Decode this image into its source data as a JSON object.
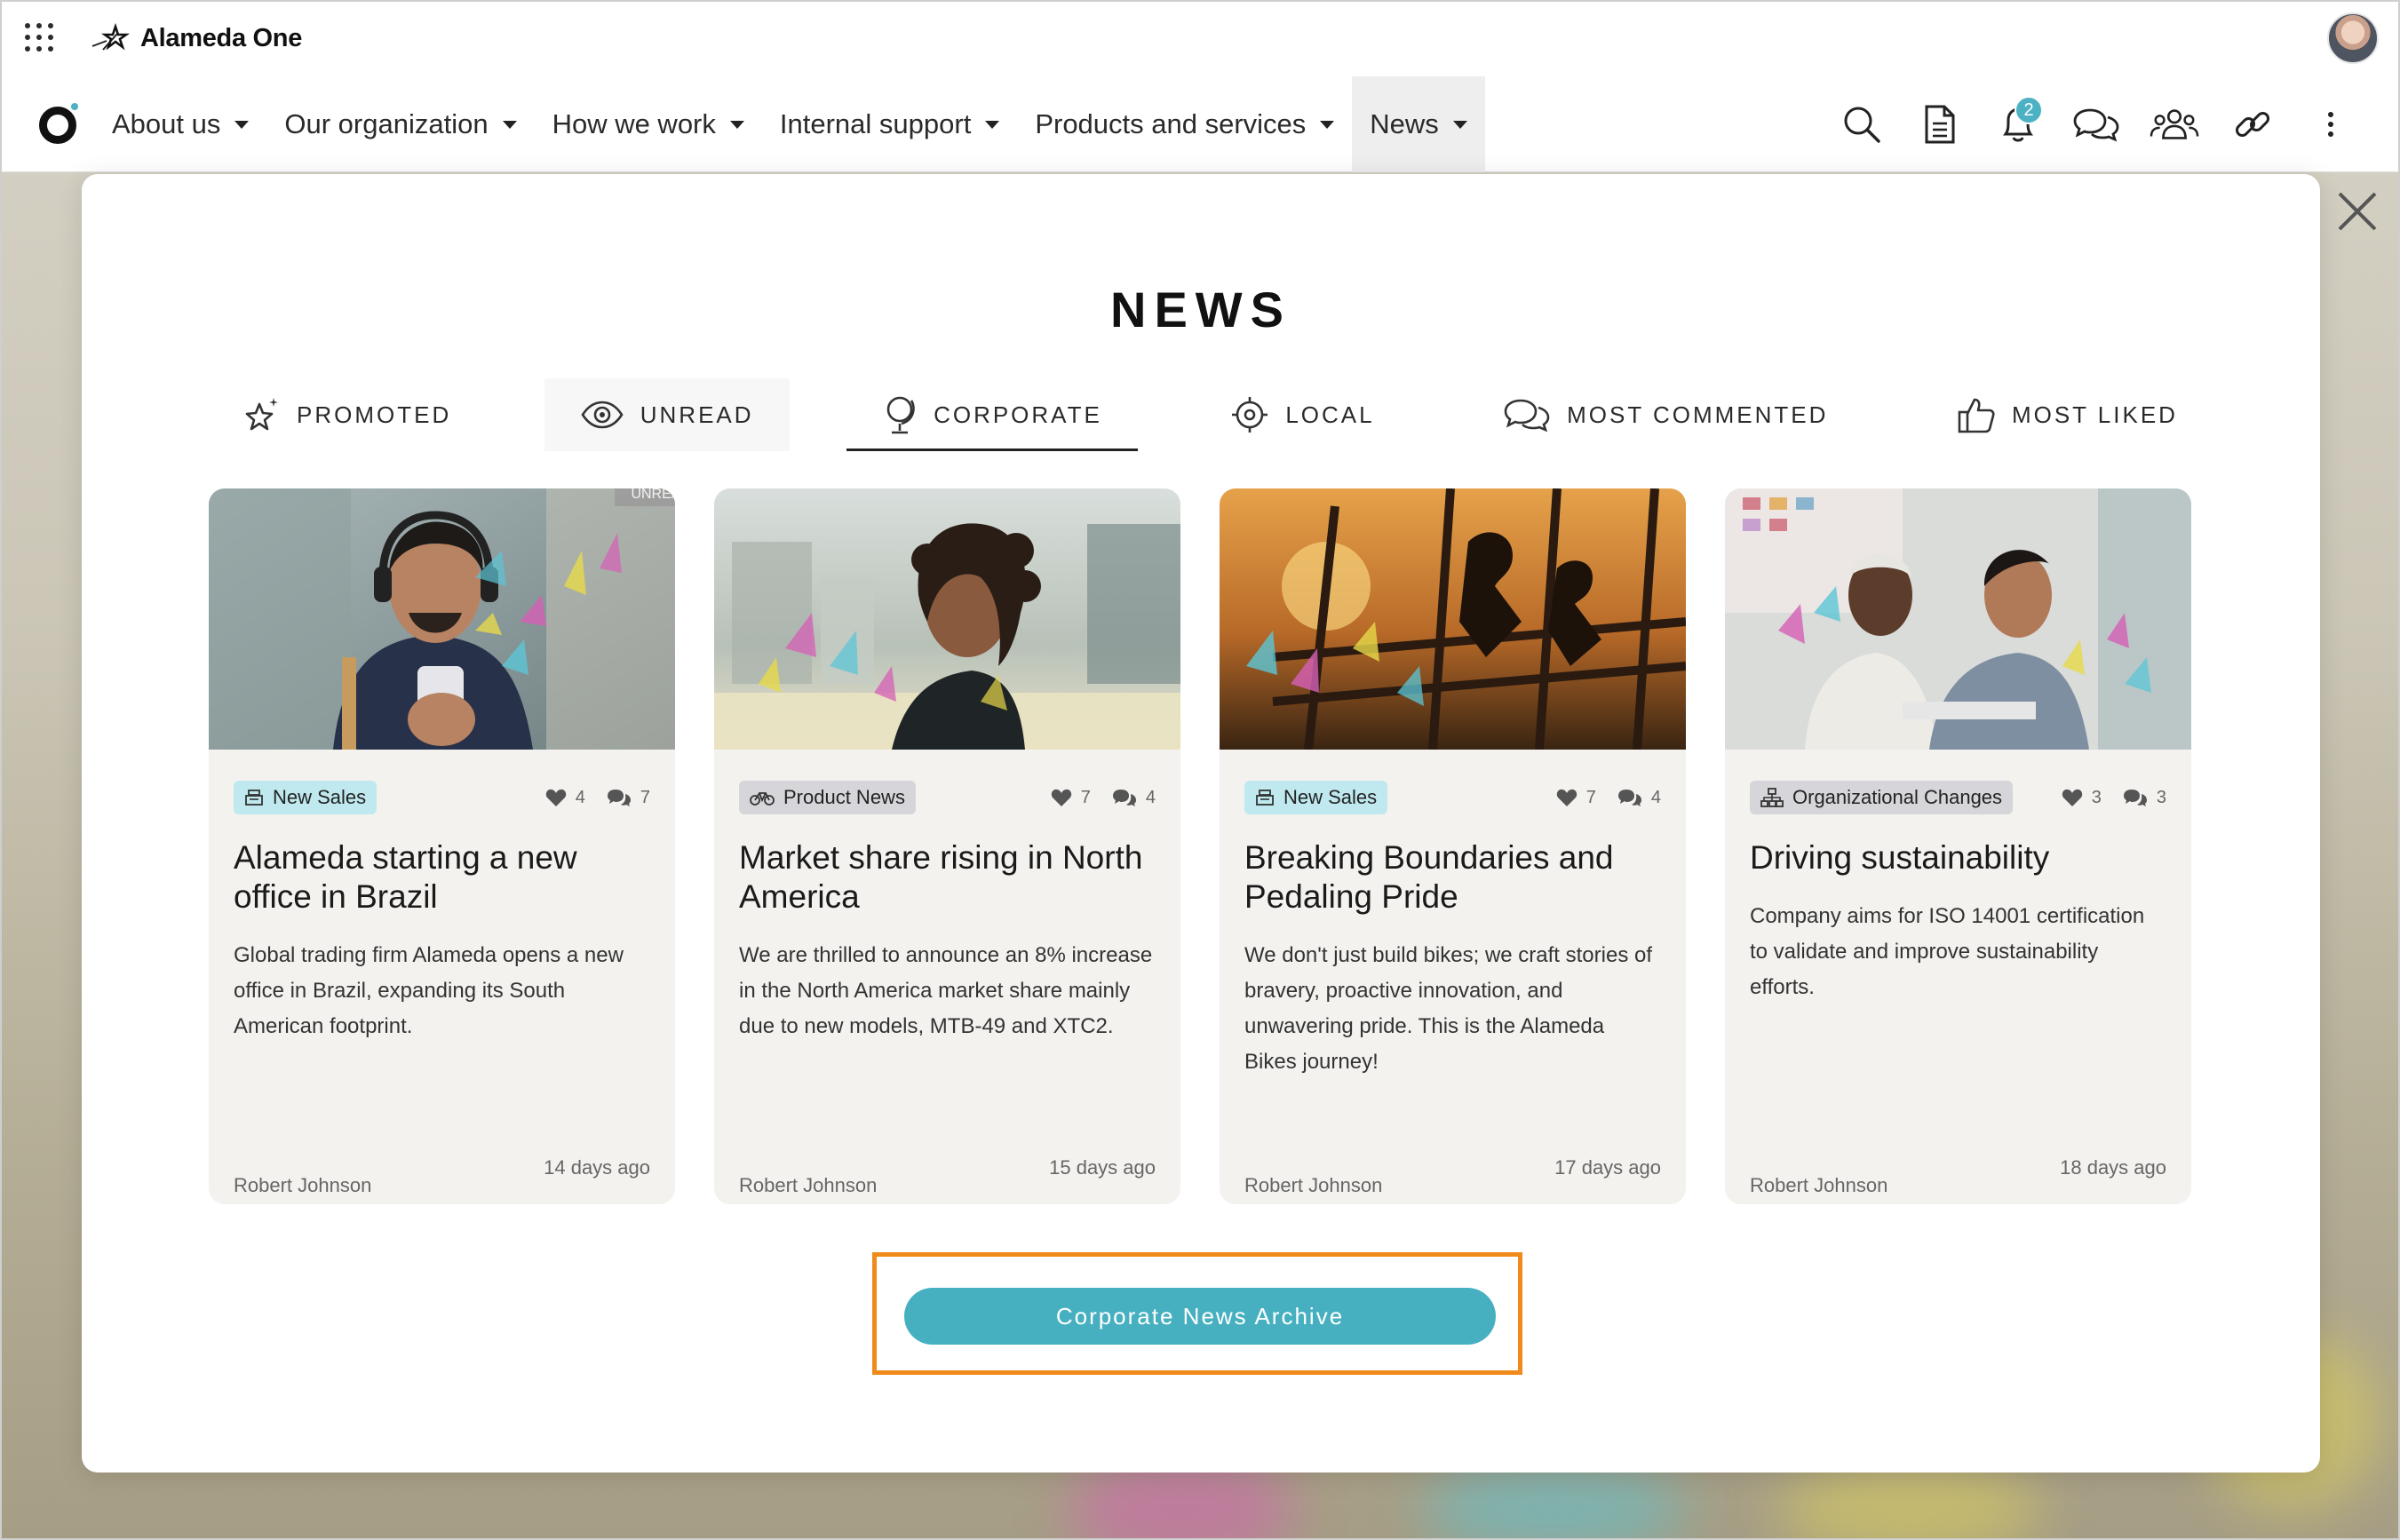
{
  "app": {
    "brand_name": "Alameda One"
  },
  "nav": {
    "items": [
      {
        "label": "About us"
      },
      {
        "label": "Our organization"
      },
      {
        "label": "How we work"
      },
      {
        "label": "Internal support"
      },
      {
        "label": "Products and services"
      },
      {
        "label": "News"
      }
    ],
    "active_item": "News",
    "icons": [
      "search-icon",
      "document-icon",
      "bell-icon",
      "chat-icon",
      "people-icon",
      "link-icon",
      "more-vertical-icon"
    ],
    "notification_count": "2"
  },
  "news": {
    "title": "NEWS",
    "tabs": [
      {
        "label": "PROMOTED",
        "icon": "sparkle-star-icon"
      },
      {
        "label": "UNREAD",
        "icon": "eye-icon"
      },
      {
        "label": "CORPORATE",
        "icon": "globe-icon"
      },
      {
        "label": "LOCAL",
        "icon": "target-icon"
      },
      {
        "label": "MOST COMMENTED",
        "icon": "chat-bubbles-icon"
      },
      {
        "label": "MOST LIKED",
        "icon": "thumbs-up-icon"
      }
    ],
    "active_tab": "CORPORATE",
    "unread_label": "UNREAD",
    "cards": [
      {
        "category": "New Sales",
        "category_icon": "cash-register-icon",
        "likes": "4",
        "comments": "7",
        "title": "Alameda starting a new office in Brazil",
        "description": "Global trading firm Alameda opens a new office in Brazil, expanding its South American footprint.",
        "author": "Robert Johnson",
        "date": "14 days ago",
        "unread": true
      },
      {
        "category": "Product News",
        "category_icon": "bicycle-icon",
        "likes": "7",
        "comments": "4",
        "title": "Market share rising in North America",
        "description": "We are thrilled to announce an 8% increase in the North America market share mainly due to new models, MTB-49 and XTC2.",
        "author": "Robert Johnson",
        "date": "15 days ago",
        "unread": false
      },
      {
        "category": "New Sales",
        "category_icon": "cash-register-icon",
        "likes": "7",
        "comments": "4",
        "title": "Breaking Boundaries and Pedaling Pride",
        "description": "We don't just build bikes; we craft stories of bravery, proactive innovation, and unwavering pride. This is the Alameda Bikes journey!",
        "author": "Robert Johnson",
        "date": "17 days ago",
        "unread": false
      },
      {
        "category": "Organizational Changes",
        "category_icon": "org-chart-icon",
        "likes": "3",
        "comments": "3",
        "title": "Driving sustainability",
        "description": "Company aims for ISO 14001 certification to validate and improve sustainability efforts.",
        "author": "Robert Johnson",
        "date": "18 days ago",
        "unread": false
      }
    ],
    "archive_button": "Corporate News Archive"
  },
  "colors": {
    "accent": "#47b0c0",
    "highlight_outline": "#f08a1a",
    "category_blue": "#bfe9ef",
    "category_gray": "#d6d6da"
  }
}
